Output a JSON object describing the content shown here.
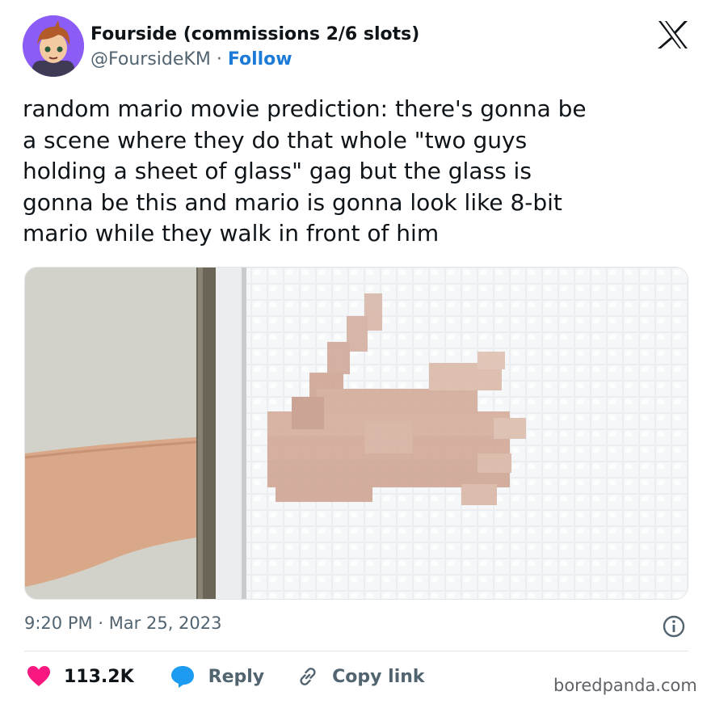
{
  "author": {
    "display_name": "Fourside (commissions 2/6 slots)",
    "handle": "@FoursideKM",
    "separator": "·",
    "follow_label": "Follow"
  },
  "tweet": {
    "text": "random mario movie prediction: there's gonna be\na scene where they do that whole \"two guys\nholding a sheet of glass\" gag but the glass is\ngonna be this and mario is gonna look like 8-bit\nmario while they walk in front of him",
    "time": "9:20 PM",
    "separator": "·",
    "date": "Mar 25, 2023"
  },
  "actions": {
    "like_count": "113.2K",
    "reply_label": "Reply",
    "copy_link_label": "Copy link"
  },
  "watermark": "boredpanda.com",
  "colors": {
    "like": "#f91880",
    "reply": "#1d9bf0",
    "follow": "#1d7bd8",
    "muted": "#536471"
  },
  "icons": [
    "x-logo-icon",
    "info-icon",
    "heart-icon",
    "speech-bubble-icon",
    "link-icon"
  ]
}
